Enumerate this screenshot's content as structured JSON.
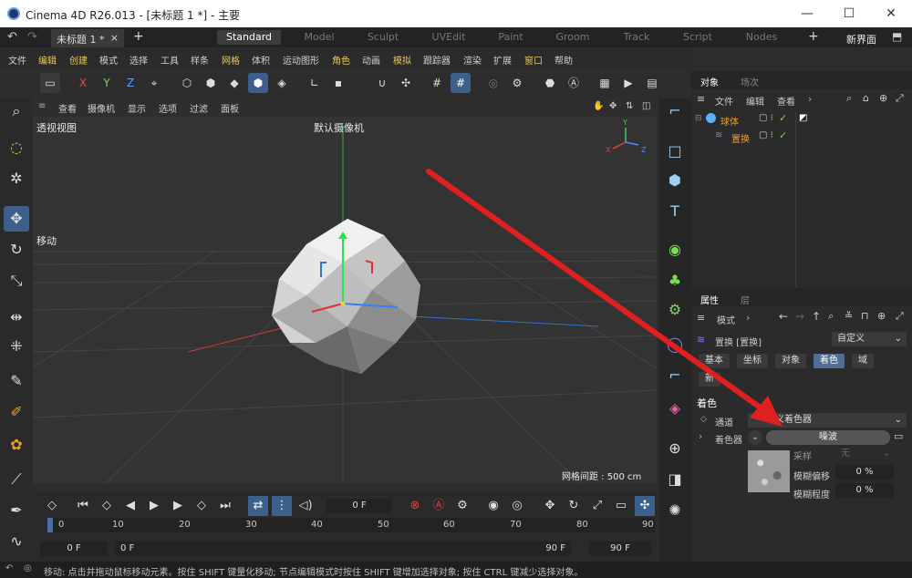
{
  "window": {
    "title": "Cinema 4D R26.013 - [未标题 1 *] - 主要",
    "min": "—",
    "max": "☐",
    "close": "✕"
  },
  "tabs": {
    "doc": "未标题 1 *",
    "doc_close": "×",
    "add": "+",
    "layouts": [
      "Standard",
      "Model",
      "Sculpt",
      "UVEdit",
      "Paint",
      "Groom",
      "Track",
      "Script",
      "Nodes"
    ],
    "new_ui": "新界面"
  },
  "menu": [
    "文件",
    "编辑",
    "创建",
    "模式",
    "选择",
    "工具",
    "样条",
    "网格",
    "体积",
    "运动图形",
    "角色",
    "动画",
    "模拟",
    "跟踪器",
    "渲染",
    "扩展",
    "窗口",
    "帮助"
  ],
  "toolbar": {
    "x": "X",
    "y": "Y",
    "z": "Z"
  },
  "viewmenu": [
    "查看",
    "摄像机",
    "显示",
    "选项",
    "过滤",
    "面板"
  ],
  "viewport": {
    "label": "透视视图",
    "camera": "默认摄像机",
    "move_label": "移动",
    "grid_distance": "网格间距 : 500 cm",
    "axis_y": "Y",
    "axis_x": "X",
    "axis_z": "Z"
  },
  "objects": {
    "tabs": [
      "对象",
      "场次"
    ],
    "menu": [
      "文件",
      "编辑",
      "查看"
    ],
    "items": [
      {
        "name": "球体"
      },
      {
        "name": "置换"
      }
    ]
  },
  "attributes": {
    "tabs": [
      "属性",
      "层"
    ],
    "mode": "模式",
    "object_name": "置换 [置换]",
    "custom": "自定义",
    "chips": [
      "基本",
      "坐标",
      "对象",
      "着色",
      "域"
    ],
    "chip_extra": "新",
    "section": "着色",
    "channel_label": "通道",
    "channel_value": "义着色器",
    "shader_label": "着色器",
    "shader_value": "噪波",
    "sample_label": "采样",
    "sample_value": "无",
    "blur_offset_label": "模糊偏移",
    "blur_offset_value": "0 %",
    "blur_scale_label": "模糊程度",
    "blur_scale_value": "0 %"
  },
  "timeline": {
    "frame": "0 F",
    "ticks": [
      "0",
      "10",
      "20",
      "30",
      "40",
      "50",
      "60",
      "70",
      "80",
      "90"
    ],
    "start": "0 F",
    "start2": "0 F",
    "end": "90 F",
    "end2": "90 F"
  },
  "status": "移动: 点击并拖动鼠标移动元素。按住 SHIFT 键量化移动; 节点编辑模式时按住 SHIFT 键增加选择对象; 按住 CTRL 键减少选择对象。",
  "colors": {
    "accent": "#3d5f8c",
    "highlight": "#e8c75a",
    "arrow": "#e02020"
  }
}
